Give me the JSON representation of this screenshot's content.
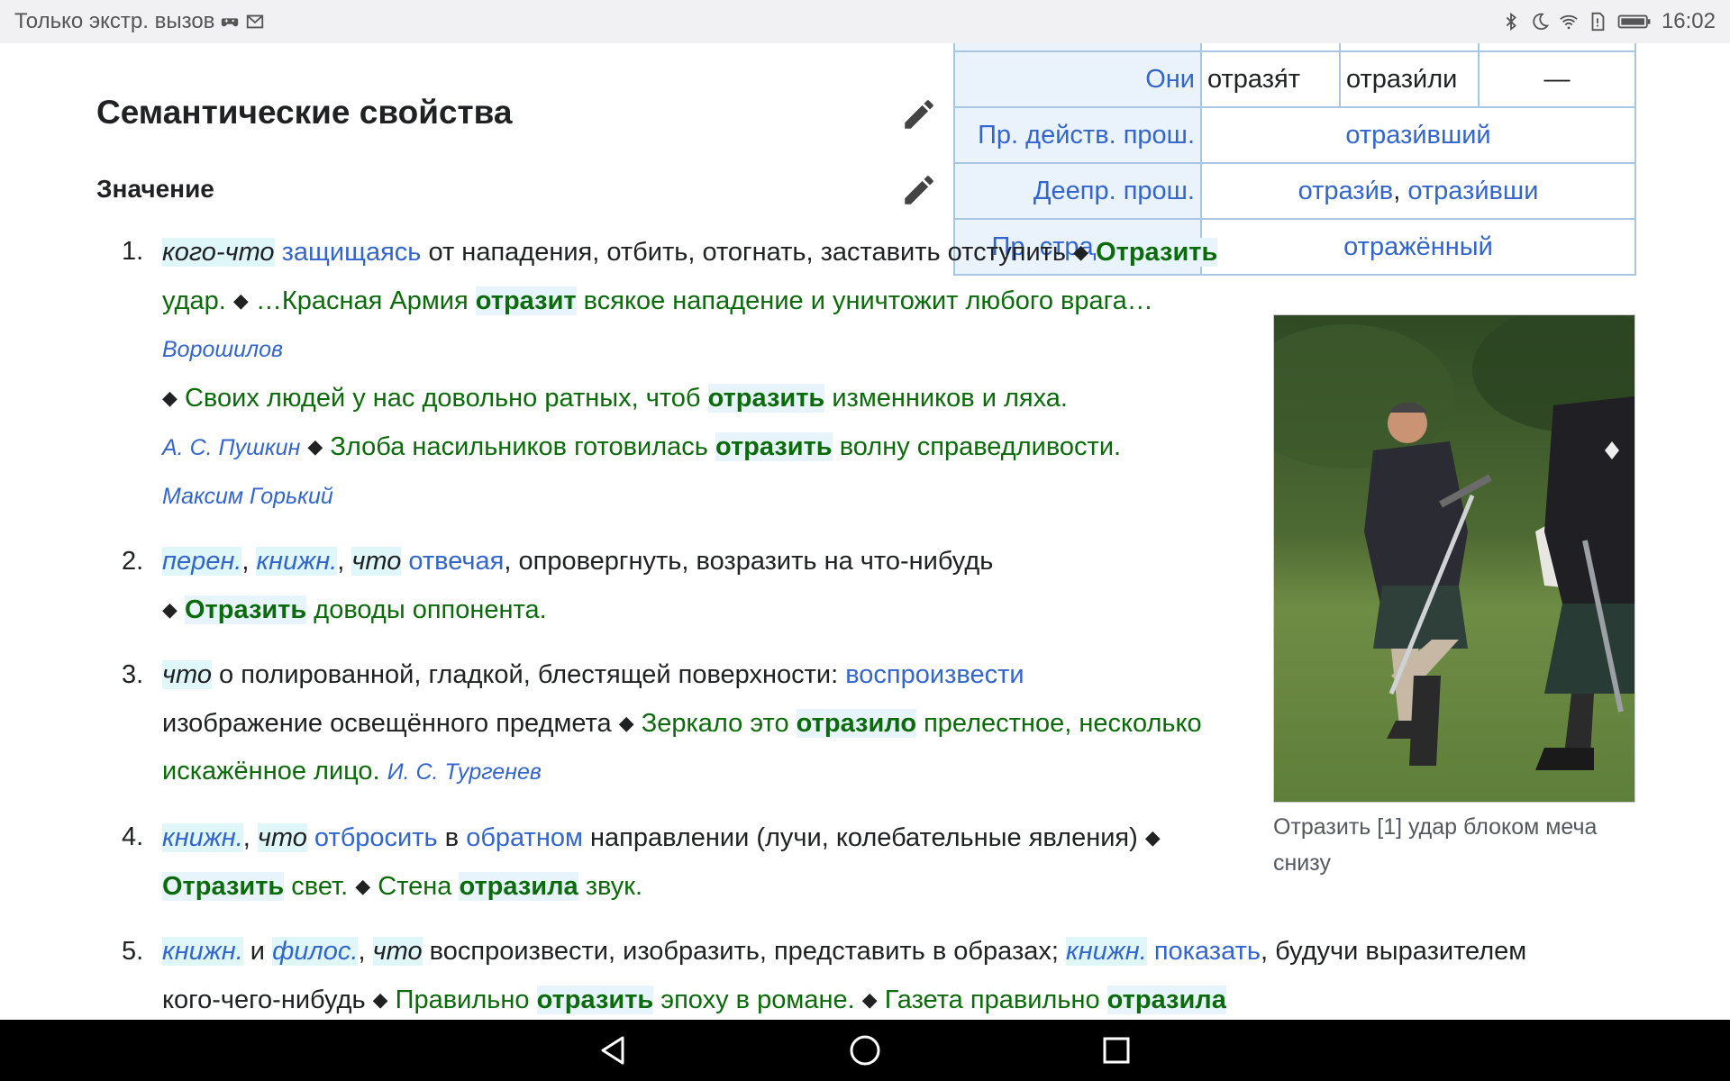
{
  "status_bar": {
    "left_text": "Только экстр. вызов",
    "time": "16:02",
    "icons": [
      "gamepad-icon",
      "mail-icon",
      "bluetooth-icon",
      "moon-icon",
      "wifi-icon",
      "sim-icon",
      "battery-icon"
    ]
  },
  "section_title": "Семантические свойства",
  "subsection_title": "Значение",
  "conjugation_table": {
    "rows": [
      {
        "header": "Они",
        "c1": "отразя́т",
        "c2": "отрази́ли",
        "c3": "—"
      },
      {
        "header": "Пр. действ. прош.",
        "merged": "отрази́вший"
      },
      {
        "header": "Деепр. прош.",
        "merged_a": "отрази́в",
        "sep": ", ",
        "merged_b": "отрази́вши"
      },
      {
        "header": "Пр. страд. прош.",
        "merged": "отражённый"
      }
    ]
  },
  "image_caption": "Отразить [1] удар блоком меча снизу",
  "definitions": [
    {
      "num": "1.",
      "label_a": "кого-что",
      "link_a": "защищаясь",
      "text_a": " от нападения, отбить, отогнать, заставить отступить ",
      "diamond": "◆",
      "ex1_bold": "Отразить",
      "ex1_rest": " удар.",
      "ex2_pre": "…Красная Армия ",
      "ex2_bold": "отразит",
      "ex2_rest": " всякое нападение и уничтожит любого врага…",
      "ex2_author": "Ворошилов",
      "ex3_pre": "Своих людей у нас довольно ратных, чтоб ",
      "ex3_bold": "отразить",
      "ex3_rest": " изменников и ляха.",
      "ex3_author": "А. С. Пушкин",
      "ex4_pre": "Злоба насильников готовилась ",
      "ex4_bold": "отразить",
      "ex4_rest": " волну справедливости.",
      "ex4_author": "Максим Горький"
    },
    {
      "num": "2.",
      "label_a": "перен.",
      "label_b": "книжн.",
      "label_c": "что",
      "link_a": "отвечая",
      "text_a": ", опровергнуть, возразить на что-нибудь",
      "ex1_bold": "Отразить",
      "ex1_rest": " доводы оппонента."
    },
    {
      "num": "3.",
      "label_a": "что",
      "text_a": " о полированной, гладкой, блестящей поверхности: ",
      "link_a": "воспроизвести",
      "text_b": " изображение освещённого предмета ",
      "ex1_pre": "Зеркало это ",
      "ex1_bold": "отразило",
      "ex1_rest": " прелестное, несколько искажённое лицо.",
      "ex1_author": "И. С. Тургенев"
    },
    {
      "num": "4.",
      "label_a": "книжн.",
      "label_b": "что",
      "link_a": "отбросить",
      "text_a": " в ",
      "link_b": "обратном",
      "text_b": " направлении (лучи, колебательные явления) ",
      "ex1_bold": "Отразить",
      "ex1_rest": " свет.",
      "ex2_pre": "Стена ",
      "ex2_bold": "отразила",
      "ex2_rest": " звук."
    },
    {
      "num": "5.",
      "label_a": "книжн.",
      "text_and": " и ",
      "label_b": "филос.",
      "label_c": "что",
      "text_a": " воспроизвести, изобразить, представить в образах; ",
      "label_d": "книжн.",
      "link_a": "показать",
      "text_b": ", будучи выразителем кого-чего-нибудь ",
      "ex1_pre": "Правильно ",
      "ex1_bold": "отразить",
      "ex1_rest": " эпоху в романе.",
      "ex2_pre": "Газета правильно ",
      "ex2_bold": "отразила"
    }
  ],
  "nav_bar": {
    "buttons": [
      "back-icon",
      "home-icon",
      "recents-icon"
    ]
  }
}
